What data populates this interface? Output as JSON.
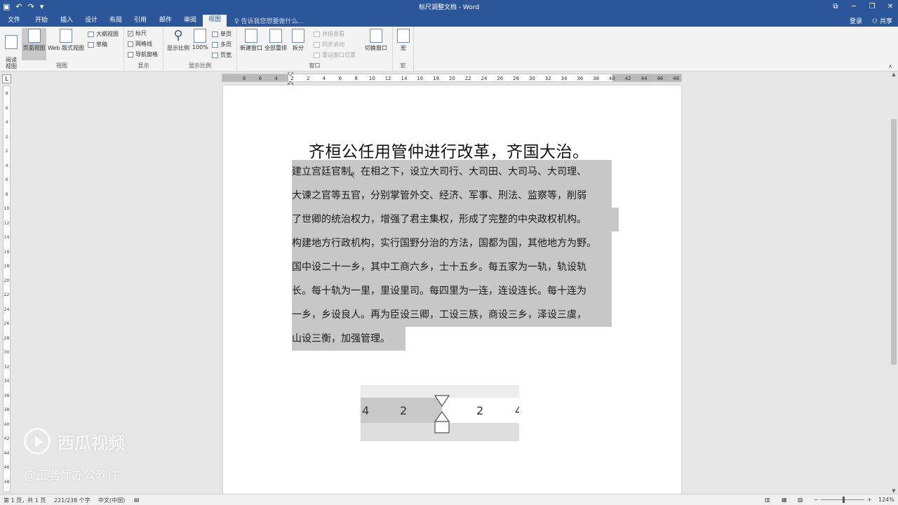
{
  "window": {
    "title": "标尺调整文档 - Word",
    "controls": [
      "⧉",
      "─",
      "❐",
      "✕"
    ]
  },
  "qat": {
    "save_icon": "▣",
    "undo_icon": "↶",
    "redo_icon": "↷",
    "more_icon": "▾"
  },
  "tabs": [
    {
      "label": "文件"
    },
    {
      "label": "开始"
    },
    {
      "label": "插入"
    },
    {
      "label": "设计"
    },
    {
      "label": "布局"
    },
    {
      "label": "引用"
    },
    {
      "label": "邮件"
    },
    {
      "label": "审阅"
    },
    {
      "label": "视图"
    }
  ],
  "tellme": "告诉我您想要做什么...",
  "account": {
    "login": "登录",
    "share": "共享"
  },
  "ribbon": {
    "views": {
      "label": "视图",
      "read_mode": "阅读\n视图",
      "print_layout": "页面视图",
      "web_layout": "Web 版式视图",
      "outline": "大纲视图",
      "draft": "草稿"
    },
    "show": {
      "label": "显示",
      "ruler": "标尺",
      "gridlines": "网格线",
      "nav_pane": "导航窗格"
    },
    "zoom": {
      "label": "显示比例",
      "zoom": "显示比例",
      "hundred": "100%",
      "one_page": "单页",
      "multi_page": "多页",
      "page_width": "页宽"
    },
    "window": {
      "label": "窗口",
      "new_window": "新建窗口",
      "arrange_all": "全部重排",
      "split": "拆分",
      "side_by_side": "并排查看",
      "sync_scroll": "同步滚动",
      "reset_pos": "重设窗口位置",
      "switch": "切换窗口"
    },
    "macros": {
      "label": "宏",
      "macro": "宏"
    }
  },
  "ruler": {
    "corner": "L",
    "ticks": [
      "8",
      "6",
      "4",
      "2",
      "2",
      "4",
      "6",
      "8",
      "10",
      "12",
      "14",
      "16",
      "18",
      "20",
      "22",
      "24",
      "26",
      "28",
      "30",
      "32",
      "34",
      "36",
      "38",
      "40",
      "42",
      "44",
      "46",
      "48"
    ]
  },
  "document": {
    "title": "齐桓公任用管仲进行改革，齐国大治。",
    "lines": [
      "建立宫廷官制。在相之下，设立大司行、大司田、大司马、大司理、",
      "大谏之官等五官，分别掌管外交、经济、军事、刑法、监察等，削弱",
      "了世卿的统治权力，增强了君主集权，形成了完整的中央政权机构。",
      "构建地方行政机构，实行国野分治的方法，国都为国，其他地方为野。",
      "国中设二十一乡，其中工商六乡，士十五乡。每五家为一轨，轨设轨",
      "长。每十轨为一里，里设里司。每四里为一连，连设连长。每十连为",
      "一乡，乡设良人。再为臣设三卿，工设三族，商设三乡，泽设三虞，",
      "山设三衡，加强管理。"
    ]
  },
  "inset": {
    "nums": [
      "4",
      "2",
      "2",
      "4"
    ]
  },
  "watermark": {
    "brand": "西瓜视频",
    "author": "@王老师办公软件"
  },
  "status": {
    "page": "第 1 页，共 1 页",
    "words": "221/238 个字",
    "lang": "中文(中国)",
    "zoom": "124%"
  }
}
